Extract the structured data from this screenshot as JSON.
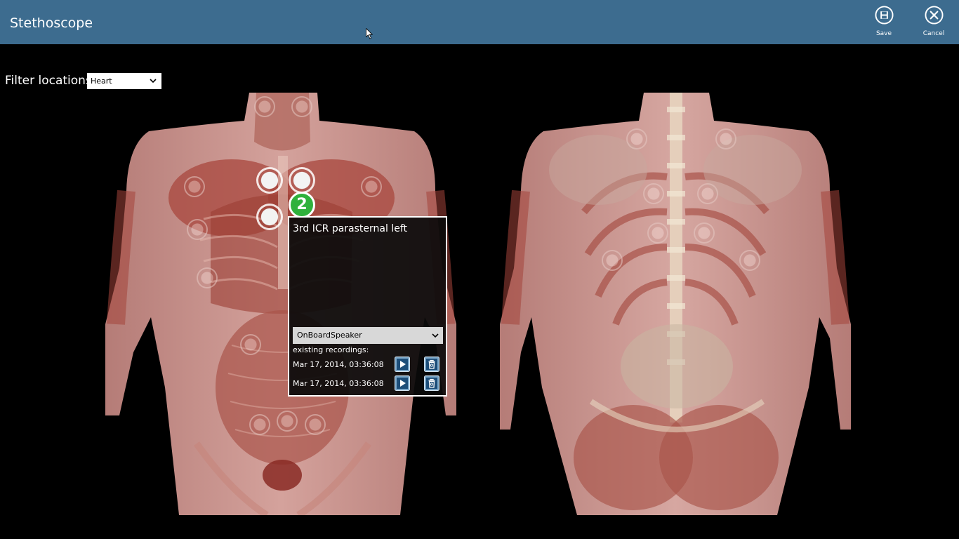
{
  "app": {
    "title": "Stethoscope"
  },
  "appbar": {
    "save": {
      "label": "Save",
      "icon": "save-icon"
    },
    "cancel": {
      "label": "Cancel",
      "icon": "close-icon"
    }
  },
  "filter": {
    "label": "Filter locations:",
    "selected": "Heart"
  },
  "popup": {
    "title": "3rd ICR parasternal left",
    "output_device": "OnBoardSpeaker",
    "recordings_label": "existing recordings:",
    "recordings": [
      {
        "date": "Mar 17, 2014, 03:36:08"
      },
      {
        "date": "Mar 17, 2014, 03:36:08"
      }
    ]
  },
  "selected_location": {
    "number": "2"
  },
  "colors": {
    "topbar": "#3d6c8f",
    "selected_marker": "#2fb13c",
    "background": "#000000",
    "skin": "#c9908a",
    "muscle": "#a4443a"
  }
}
